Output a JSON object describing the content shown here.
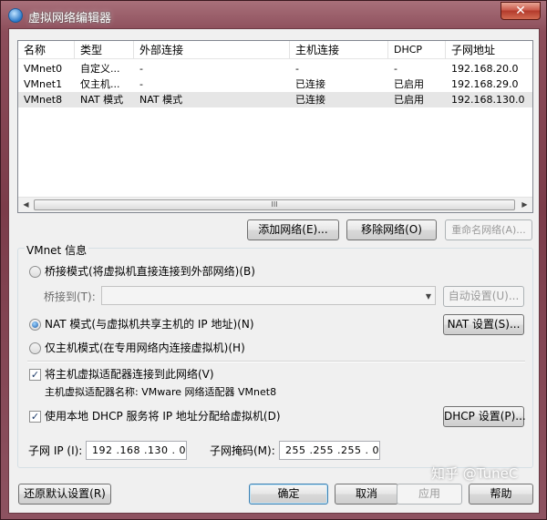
{
  "window": {
    "title": "虚拟网络编辑器",
    "close_label": "✕"
  },
  "list": {
    "columns": [
      "名称",
      "类型",
      "外部连接",
      "主机连接",
      "DHCP",
      "子网地址"
    ],
    "rows": [
      [
        "VMnet0",
        "自定义...",
        "-",
        "-",
        "-",
        "192.168.20.0"
      ],
      [
        "VMnet1",
        "仅主机...",
        "-",
        "已连接",
        "已启用",
        "192.168.29.0"
      ],
      [
        "VMnet8",
        "NAT 模式",
        "NAT 模式",
        "已连接",
        "已启用",
        "192.168.130.0"
      ]
    ],
    "selected_row": 2,
    "scroll_left": "◀",
    "scroll_right": "▶",
    "scroll_grip": "III"
  },
  "list_buttons": {
    "add": "添加网络(E)...",
    "remove": "移除网络(O)",
    "rename": "重命名网络(A)..."
  },
  "vmnet_info": {
    "title": "VMnet 信息",
    "bridged_label": "桥接模式(将虚拟机直接连接到外部网络)(B)",
    "bridged_to_label": "桥接到(T):",
    "bridged_to_value": "",
    "auto_settings": "自动设置(U)...",
    "nat_label": "NAT 模式(与虚拟机共享主机的 IP 地址)(N)",
    "nat_settings": "NAT 设置(S)...",
    "hostonly_label": "仅主机模式(在专用网络内连接虚拟机)(H)",
    "selected_mode": "nat",
    "connect_adapter_label": "将主机虚拟适配器连接到此网络(V)",
    "connect_adapter_checked": true,
    "adapter_name_label": "主机虚拟适配器名称: VMware 网络适配器 VMnet8",
    "dhcp_label": "使用本地 DHCP 服务将 IP 地址分配给虚拟机(D)",
    "dhcp_checked": true,
    "dhcp_settings": "DHCP 设置(P)...",
    "subnet_ip_label": "子网 IP (I):",
    "subnet_ip_value": "192 .168 .130 .  0",
    "subnet_mask_label": "子网掩码(M):",
    "subnet_mask_value": "255 .255 .255 .  0",
    "check_mark": "✓"
  },
  "footer": {
    "restore": "还原默认设置(R)",
    "ok": "确定",
    "cancel": "取消",
    "apply": "应用",
    "help": "帮助"
  },
  "watermark": "知乎 @TuneC"
}
